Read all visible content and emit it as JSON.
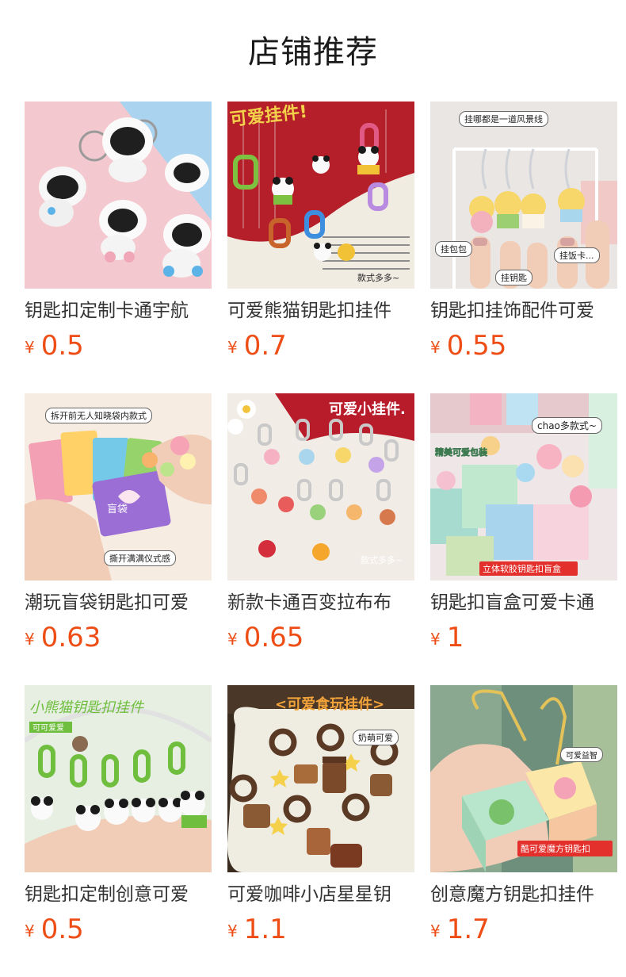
{
  "header": {
    "title": "店铺推荐"
  },
  "currency": "¥",
  "products": [
    {
      "name": "钥匙扣定制卡通宇航",
      "price": "0.5",
      "image_theme": "astronaut-keychains"
    },
    {
      "name": "可爱熊猫钥匙扣挂件",
      "price": "0.7",
      "image_theme": "panda-pendants",
      "image_text": [
        "可爱挂件!",
        "款式多多~"
      ]
    },
    {
      "name": "钥匙扣挂饰配件可爱",
      "price": "0.55",
      "image_theme": "duck-keychains",
      "image_text": [
        "挂哪都是一道风景线",
        "挂包包",
        "挂钥匙",
        "挂饭卡..."
      ]
    },
    {
      "name": "潮玩盲袋钥匙扣可爱",
      "price": "0.63",
      "image_theme": "blind-bags",
      "image_text": [
        "拆开前无人知晓袋内款式",
        "撕开满满仪式感",
        "盲袋"
      ]
    },
    {
      "name": "新款卡通百变拉布布",
      "price": "0.65",
      "image_theme": "labubu-pendants",
      "image_text": [
        "可爱小挂件.",
        "款式多多~"
      ]
    },
    {
      "name": "钥匙扣盲盒可爱卡通",
      "price": "1",
      "image_theme": "blind-box",
      "image_text": [
        "chao多款式~",
        "精美可爱包装",
        "立体软胶钥匙扣盲盒"
      ]
    },
    {
      "name": "钥匙扣定制创意可爱",
      "price": "0.5",
      "image_theme": "green-panda-keychains",
      "image_text": [
        "小熊猫钥匙扣挂件",
        "可可爱爱"
      ]
    },
    {
      "name": "可爱咖啡小店星星钥",
      "price": "1.1",
      "image_theme": "coffee-keychains",
      "image_text": [
        "<可爱食玩挂件>",
        "奶萌可爱"
      ]
    },
    {
      "name": "创意魔方钥匙扣挂件",
      "price": "1.7",
      "image_theme": "cube-keychain",
      "image_text": [
        "可爱益智",
        "酷可爱魔方钥匙扣"
      ]
    }
  ]
}
